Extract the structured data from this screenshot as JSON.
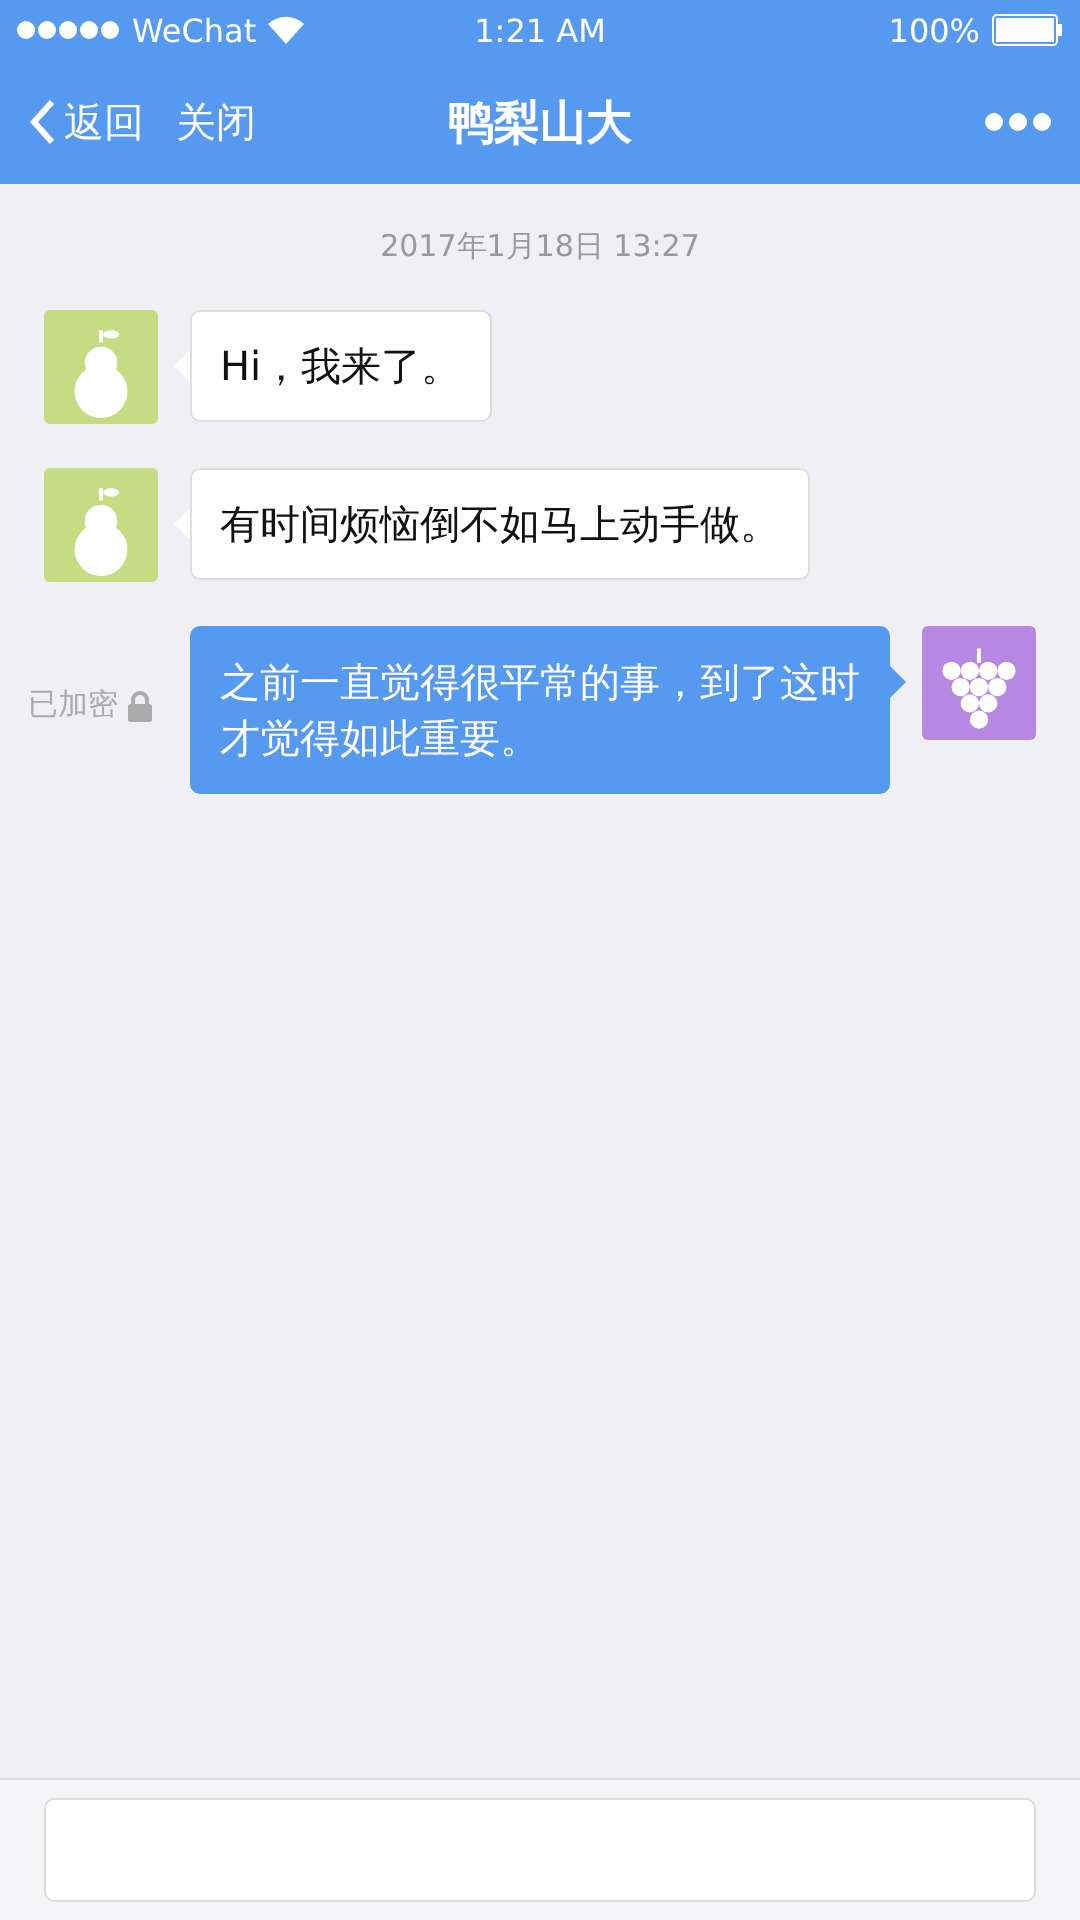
{
  "status_bar": {
    "carrier": "WeChat",
    "time": "1:21 AM",
    "battery": "100%"
  },
  "nav": {
    "back": "返回",
    "close": "关闭",
    "title": "鸭梨山大"
  },
  "timestamp": "2017年1月18日 13:27",
  "messages": [
    {
      "kind": "received",
      "text": "Hi，我来了。"
    },
    {
      "kind": "received",
      "text": "有时间烦恼倒不如马上动手做。"
    },
    {
      "kind": "sent",
      "text": "之前一直觉得很平常的事，到了这时才觉得如此重要。",
      "note": "已加密"
    }
  ]
}
